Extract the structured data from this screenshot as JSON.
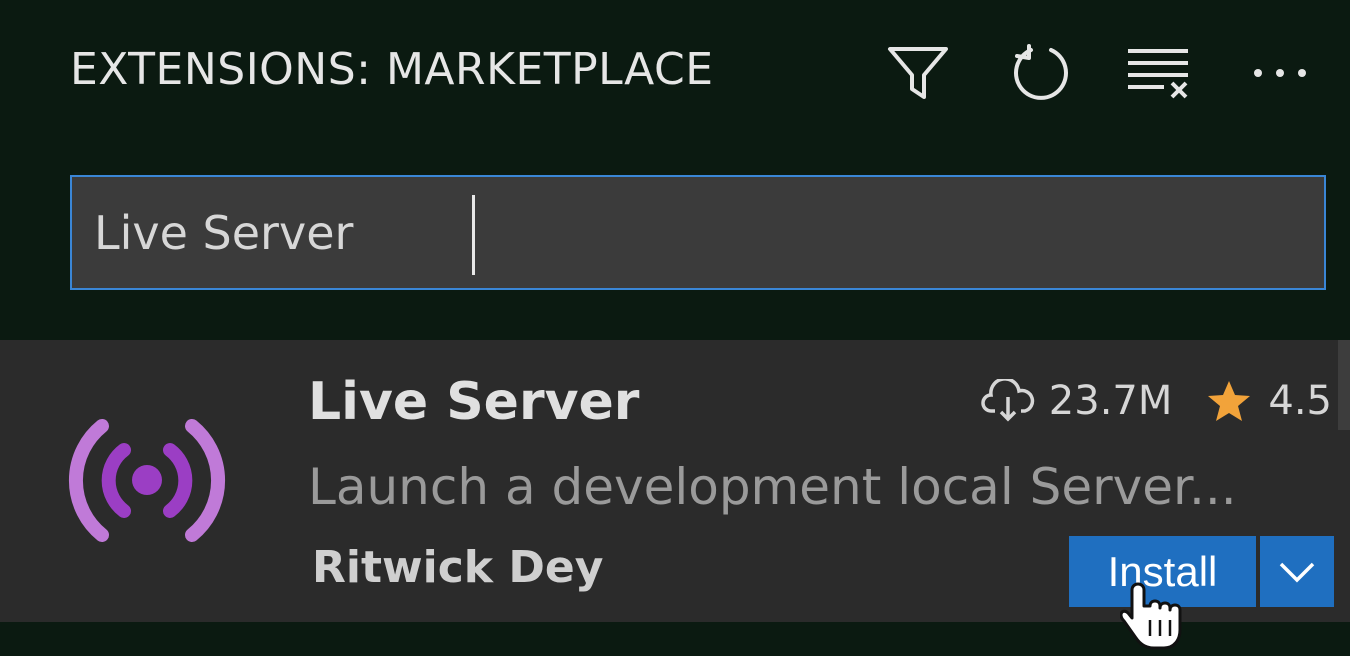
{
  "header": {
    "title": "EXTENSIONS: MARKETPLACE",
    "actions": [
      {
        "name": "filter-icon"
      },
      {
        "name": "refresh-icon"
      },
      {
        "name": "clear-results-icon"
      },
      {
        "name": "more-actions-icon"
      }
    ]
  },
  "search": {
    "value": "Live Server",
    "placeholder": ""
  },
  "extension": {
    "name": "Live Server",
    "description": "Launch a development local Server...",
    "publisher": "Ritwick Dey",
    "downloads": "23.7M",
    "rating": "4.5",
    "install_label": "Install",
    "icon": "broadcast-icon",
    "logo_color": "#9b3ec4",
    "star_color": "#f2a33a"
  },
  "colors": {
    "background": "#0b1a11",
    "input_bg": "#3b3b3b",
    "focus_border": "#3a86d6",
    "card_bg": "#2b2b2b",
    "button_bg": "#1f6fc0"
  }
}
